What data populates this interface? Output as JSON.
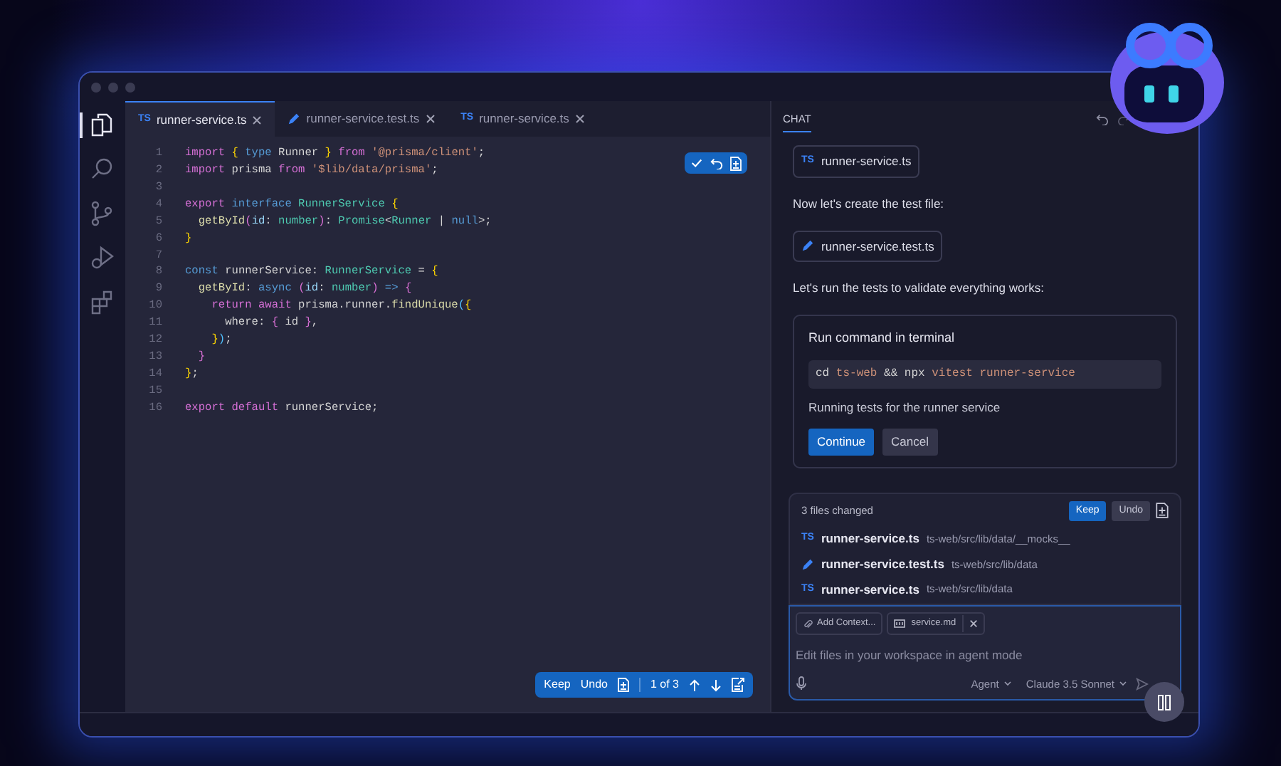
{
  "activity_bar": [
    {
      "kind": "files",
      "selected": true
    },
    {
      "kind": "search",
      "selected": false
    },
    {
      "kind": "branch",
      "selected": false
    },
    {
      "kind": "run",
      "selected": false
    },
    {
      "kind": "extensions",
      "selected": false
    }
  ],
  "tabs": [
    {
      "kind": "ts",
      "badge": "TS",
      "label": "runner-service.ts",
      "selected": true
    },
    {
      "kind": "pen",
      "label": "runner-service.test.ts",
      "selected": false
    },
    {
      "kind": "ts",
      "badge": "TS",
      "label": "runner-service.ts",
      "selected": false
    }
  ],
  "code": [
    {
      "n": "1",
      "t": [
        {
          "kind": "keyword",
          "text": "import"
        },
        {
          "kind": "bracket",
          "text": " {"
        },
        {
          "kind": "storage",
          "text": " type"
        },
        {
          "kind": "plain",
          "text": " Runner"
        },
        {
          "kind": "bracket",
          "text": " }"
        },
        {
          "kind": "keyword",
          "text": " from"
        },
        {
          "kind": "string",
          "text": " '@prisma/client'"
        },
        {
          "kind": "plain",
          "text": ";"
        }
      ]
    },
    {
      "n": "2",
      "t": [
        {
          "kind": "keyword",
          "text": "import"
        },
        {
          "kind": "plain",
          "text": " prisma"
        },
        {
          "kind": "keyword",
          "text": " from"
        },
        {
          "kind": "string",
          "text": " '$lib/data/prisma'"
        },
        {
          "kind": "plain",
          "text": ";"
        }
      ]
    },
    {
      "n": "3"
    },
    {
      "n": "4",
      "t": [
        {
          "kind": "keyword",
          "text": "export"
        },
        {
          "kind": "storage",
          "text": " interface"
        },
        {
          "kind": "type",
          "text": " RunnerService"
        },
        {
          "kind": "bracket",
          "text": " {"
        }
      ]
    },
    {
      "n": "5",
      "t": [
        {
          "kind": "function",
          "text": "  getById"
        },
        {
          "kind": "bracket2",
          "text": "("
        },
        {
          "kind": "variable",
          "text": "id"
        },
        {
          "kind": "plain",
          "text": ":"
        },
        {
          "kind": "type",
          "text": " number"
        },
        {
          "kind": "bracket2",
          "text": ")"
        },
        {
          "kind": "plain",
          "text": ":"
        },
        {
          "kind": "type",
          "text": " Promise"
        },
        {
          "kind": "plain",
          "text": "<"
        },
        {
          "kind": "type",
          "text": "Runner"
        },
        {
          "kind": "plain",
          "text": " |"
        },
        {
          "kind": "storage",
          "text": " null"
        },
        {
          "kind": "plain",
          "text": ">;"
        }
      ]
    },
    {
      "n": "6",
      "t": [
        {
          "kind": "bracket",
          "text": "}"
        }
      ]
    },
    {
      "n": "7"
    },
    {
      "n": "8",
      "t": [
        {
          "kind": "storage",
          "text": "const"
        },
        {
          "kind": "plain",
          "text": " runnerService:"
        },
        {
          "kind": "type",
          "text": " RunnerService"
        },
        {
          "kind": "plain",
          "text": " ="
        },
        {
          "kind": "bracket",
          "text": " {"
        }
      ]
    },
    {
      "n": "9",
      "t": [
        {
          "kind": "function",
          "text": "  getById"
        },
        {
          "kind": "plain",
          "text": ":"
        },
        {
          "kind": "storage",
          "text": " async"
        },
        {
          "kind": "bracket2",
          "text": " ("
        },
        {
          "kind": "variable",
          "text": "id"
        },
        {
          "kind": "plain",
          "text": ":"
        },
        {
          "kind": "type",
          "text": " number"
        },
        {
          "kind": "bracket2",
          "text": ")"
        },
        {
          "kind": "storage",
          "text": " =>"
        },
        {
          "kind": "bracket2",
          "text": " {"
        }
      ]
    },
    {
      "n": "10",
      "t": [
        {
          "kind": "keyword",
          "text": "    return"
        },
        {
          "kind": "keyword",
          "text": " await"
        },
        {
          "kind": "plain",
          "text": " prisma.runner."
        },
        {
          "kind": "function",
          "text": "findUnique"
        },
        {
          "kind": "bracket3",
          "text": "("
        },
        {
          "kind": "bracket",
          "text": "{"
        }
      ]
    },
    {
      "n": "11",
      "t": [
        {
          "kind": "plain",
          "text": "      where:"
        },
        {
          "kind": "bracket2",
          "text": " {"
        },
        {
          "kind": "plain",
          "text": " id"
        },
        {
          "kind": "bracket2",
          "text": " }"
        },
        {
          "kind": "plain",
          "text": ","
        }
      ]
    },
    {
      "n": "12",
      "t": [
        {
          "kind": "bracket",
          "text": "    }"
        },
        {
          "kind": "bracket3",
          "text": ")"
        },
        {
          "kind": "plain",
          "text": ";"
        }
      ]
    },
    {
      "n": "13",
      "t": [
        {
          "kind": "bracket2",
          "text": "  }"
        }
      ]
    },
    {
      "n": "14",
      "t": [
        {
          "kind": "bracket",
          "text": "}"
        },
        {
          "kind": "plain",
          "text": ";"
        }
      ]
    },
    {
      "n": "15"
    },
    {
      "n": "16",
      "t": [
        {
          "kind": "keyword",
          "text": "export"
        },
        {
          "kind": "keyword",
          "text": " default"
        },
        {
          "kind": "plain",
          "text": " runnerService;"
        }
      ]
    }
  ],
  "inline_review": {
    "buttons": [
      "Keep",
      "Undo"
    ],
    "position": "1 of 3"
  },
  "chat": {
    "tab": {
      "label": "CHAT",
      "selected": true
    },
    "messages": [
      {
        "kind": "file",
        "file": {
          "kind": "ts",
          "badge": "TS",
          "label": "runner-service.ts"
        }
      },
      {
        "kind": "text",
        "text": "Now let's create the test file:"
      },
      {
        "kind": "file",
        "file": {
          "kind": "pen",
          "label": "runner-service.test.ts"
        }
      },
      {
        "kind": "text",
        "text": "Let's run the tests to validate everything works:"
      },
      {
        "kind": "command",
        "title": "Run command in terminal",
        "command": [
          {
            "kind": "plain",
            "text": "cd"
          },
          {
            "kind": "string",
            "text": " ts-web"
          },
          {
            "kind": "plain",
            "text": " && npx"
          },
          {
            "kind": "string",
            "text": " vitest runner-service"
          }
        ],
        "description": "Running tests for the runner service",
        "buttons": [
          {
            "label": "Continue",
            "primary": true
          },
          {
            "label": "Cancel",
            "primary": false
          }
        ]
      }
    ],
    "changes": {
      "title": "3 files changed",
      "keep": "Keep",
      "undo": "Undo",
      "files": [
        {
          "kind": "ts",
          "badge": "TS",
          "name": "runner-service.ts",
          "path": "ts-web/src/lib/data/__mocks__"
        },
        {
          "kind": "pen",
          "name": "runner-service.test.ts",
          "path": "ts-web/src/lib/data"
        },
        {
          "kind": "ts",
          "badge": "TS",
          "name": "runner-service.ts",
          "path": "ts-web/src/lib/data"
        }
      ]
    },
    "input": {
      "chips": [
        {
          "kind": "context",
          "label": "Add Context..."
        },
        {
          "kind": "file",
          "label": "service.md"
        }
      ],
      "placeholder": "Edit files in your workspace in agent mode",
      "mode": "Agent",
      "model": "Claude 3.5 Sonnet"
    }
  }
}
